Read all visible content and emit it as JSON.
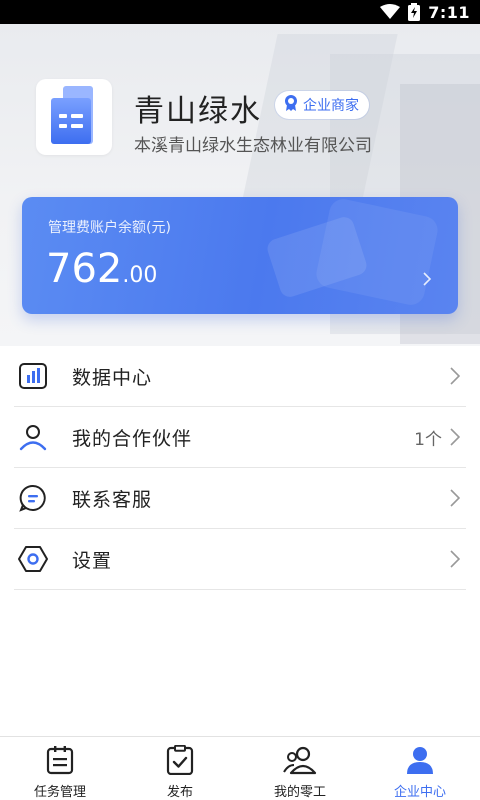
{
  "status_bar": {
    "time": "7:11",
    "icons": [
      "wifi-icon",
      "battery-charging-icon"
    ]
  },
  "company": {
    "short_name": "青山绿水",
    "full_name": "本溪青山绿水生态林业有限公司",
    "badge_label": "企业商家",
    "badge_icon": "award-icon",
    "logo_icon": "building-icon"
  },
  "balance": {
    "label": "管理费账户余额(元)",
    "amount_integer": "762",
    "amount_decimal": ".00"
  },
  "menu": {
    "items": [
      {
        "label": "数据中心",
        "icon": "chart-icon",
        "value": ""
      },
      {
        "label": "我的合作伙伴",
        "icon": "user-icon",
        "value": "1个"
      },
      {
        "label": "联系客服",
        "icon": "chat-icon",
        "value": ""
      },
      {
        "label": "设置",
        "icon": "settings-icon",
        "value": ""
      }
    ]
  },
  "bottom_nav": {
    "items": [
      {
        "label": "任务管理",
        "icon": "task-list-icon",
        "active": false
      },
      {
        "label": "发布",
        "icon": "publish-icon",
        "active": false
      },
      {
        "label": "我的零工",
        "icon": "workers-icon",
        "active": false
      },
      {
        "label": "企业中心",
        "icon": "enterprise-icon",
        "active": true
      }
    ]
  },
  "colors": {
    "accent": "#3d6ef0",
    "card_gradient_start": "#5b8cf3",
    "card_gradient_end": "#4b79ee"
  }
}
